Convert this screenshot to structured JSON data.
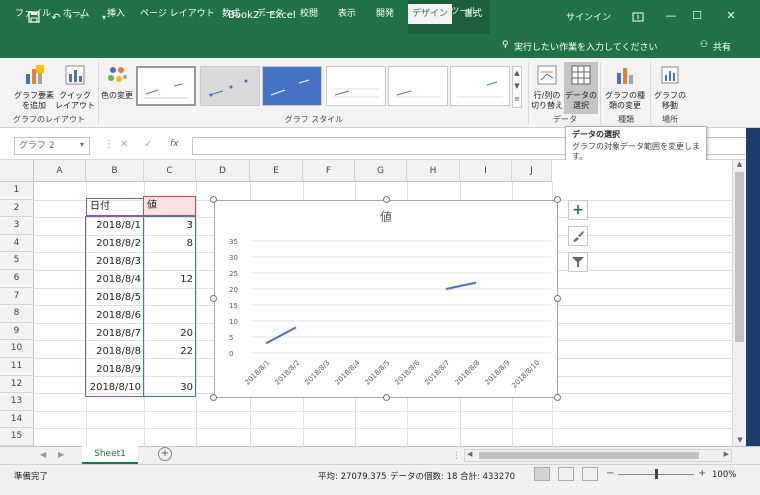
{
  "window": {
    "title": "Book2  -  Excel",
    "context_tab": "グラフ ツール",
    "signin": "サインイン"
  },
  "tabs": [
    "ファイル",
    "ホーム",
    "挿入",
    "ページ レイアウト",
    "数式",
    "データ",
    "校閲",
    "表示",
    "開発",
    "デザイン",
    "書式"
  ],
  "tell_me": "実行したい作業を入力してください",
  "share": "共有",
  "ribbon": {
    "add_element": "グラフ要素を追加",
    "quick_layout": "クイック レイアウト",
    "change_colors": "色の変更",
    "switch_rowcol": "行/列の切り替え",
    "select_data": "データの選択",
    "change_type": "グラフの種類の変更",
    "move_chart": "グラフの移動",
    "groups": {
      "layout": "グラフのレイアウト",
      "styles": "グラフ スタイル",
      "data": "データ",
      "type": "種類",
      "location": "場所"
    }
  },
  "tooltip": {
    "title": "データの選択",
    "desc": "グラフの対象データ範囲を変更します。"
  },
  "namebox": "グラフ 2",
  "fx": "fx",
  "columns": [
    "A",
    "B",
    "C",
    "D",
    "E",
    "F",
    "G",
    "H",
    "I",
    "J"
  ],
  "rows": [
    "1",
    "2",
    "3",
    "4",
    "5",
    "6",
    "7",
    "8",
    "9",
    "10",
    "11",
    "12",
    "13",
    "14",
    "15"
  ],
  "table": {
    "header_date": "日付",
    "header_value": "値",
    "dates": [
      "2018/8/1",
      "2018/8/2",
      "2018/8/3",
      "2018/8/4",
      "2018/8/5",
      "2018/8/6",
      "2018/8/7",
      "2018/8/8",
      "2018/8/9",
      "2018/8/10"
    ],
    "values": [
      "3",
      "8",
      "",
      "12",
      "",
      "",
      "20",
      "22",
      "",
      "30"
    ]
  },
  "chart_data": {
    "type": "line",
    "title": "値",
    "categories": [
      "2018/8/1",
      "2018/8/2",
      "2018/8/3",
      "2018/8/4",
      "2018/8/5",
      "2018/8/6",
      "2018/8/7",
      "2018/8/8",
      "2018/8/9",
      "2018/8/10"
    ],
    "values": [
      3,
      8,
      null,
      12,
      null,
      null,
      20,
      22,
      null,
      30
    ],
    "ylim": [
      0,
      35
    ],
    "yticks": [
      "0",
      "5",
      "10",
      "15",
      "20",
      "25",
      "30",
      "35"
    ],
    "series_color": "#4472c4",
    "grid": true
  },
  "sheet": {
    "name": "Sheet1"
  },
  "status": {
    "ready": "準備完了",
    "average": "平均: 27079.375",
    "count": "データの個数: 18",
    "sum": "合計: 433270",
    "zoom": "100%"
  },
  "colors": {
    "excel_green": "#217346",
    "date_border": "#7f5fa7",
    "value_border": "#4472c4"
  }
}
